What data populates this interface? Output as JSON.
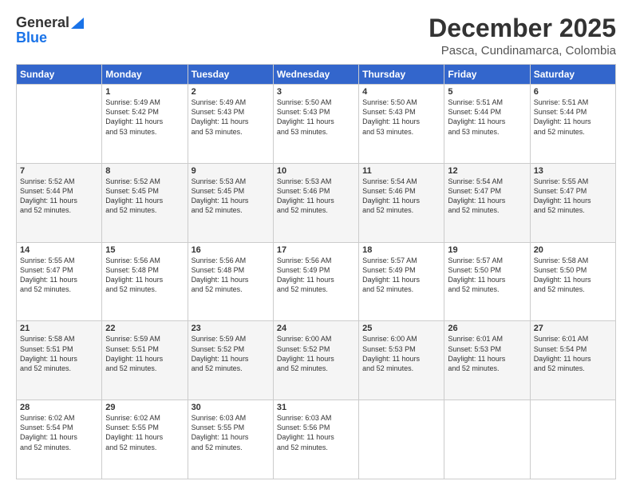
{
  "header": {
    "logo_general": "General",
    "logo_blue": "Blue",
    "title": "December 2025",
    "subtitle": "Pasca, Cundinamarca, Colombia"
  },
  "calendar": {
    "days_of_week": [
      "Sunday",
      "Monday",
      "Tuesday",
      "Wednesday",
      "Thursday",
      "Friday",
      "Saturday"
    ],
    "weeks": [
      [
        {
          "date": "",
          "info": ""
        },
        {
          "date": "1",
          "info": "Sunrise: 5:49 AM\nSunset: 5:42 PM\nDaylight: 11 hours\nand 53 minutes."
        },
        {
          "date": "2",
          "info": "Sunrise: 5:49 AM\nSunset: 5:43 PM\nDaylight: 11 hours\nand 53 minutes."
        },
        {
          "date": "3",
          "info": "Sunrise: 5:50 AM\nSunset: 5:43 PM\nDaylight: 11 hours\nand 53 minutes."
        },
        {
          "date": "4",
          "info": "Sunrise: 5:50 AM\nSunset: 5:43 PM\nDaylight: 11 hours\nand 53 minutes."
        },
        {
          "date": "5",
          "info": "Sunrise: 5:51 AM\nSunset: 5:44 PM\nDaylight: 11 hours\nand 53 minutes."
        },
        {
          "date": "6",
          "info": "Sunrise: 5:51 AM\nSunset: 5:44 PM\nDaylight: 11 hours\nand 52 minutes."
        }
      ],
      [
        {
          "date": "7",
          "info": "Sunrise: 5:52 AM\nSunset: 5:44 PM\nDaylight: 11 hours\nand 52 minutes."
        },
        {
          "date": "8",
          "info": "Sunrise: 5:52 AM\nSunset: 5:45 PM\nDaylight: 11 hours\nand 52 minutes."
        },
        {
          "date": "9",
          "info": "Sunrise: 5:53 AM\nSunset: 5:45 PM\nDaylight: 11 hours\nand 52 minutes."
        },
        {
          "date": "10",
          "info": "Sunrise: 5:53 AM\nSunset: 5:46 PM\nDaylight: 11 hours\nand 52 minutes."
        },
        {
          "date": "11",
          "info": "Sunrise: 5:54 AM\nSunset: 5:46 PM\nDaylight: 11 hours\nand 52 minutes."
        },
        {
          "date": "12",
          "info": "Sunrise: 5:54 AM\nSunset: 5:47 PM\nDaylight: 11 hours\nand 52 minutes."
        },
        {
          "date": "13",
          "info": "Sunrise: 5:55 AM\nSunset: 5:47 PM\nDaylight: 11 hours\nand 52 minutes."
        }
      ],
      [
        {
          "date": "14",
          "info": "Sunrise: 5:55 AM\nSunset: 5:47 PM\nDaylight: 11 hours\nand 52 minutes."
        },
        {
          "date": "15",
          "info": "Sunrise: 5:56 AM\nSunset: 5:48 PM\nDaylight: 11 hours\nand 52 minutes."
        },
        {
          "date": "16",
          "info": "Sunrise: 5:56 AM\nSunset: 5:48 PM\nDaylight: 11 hours\nand 52 minutes."
        },
        {
          "date": "17",
          "info": "Sunrise: 5:56 AM\nSunset: 5:49 PM\nDaylight: 11 hours\nand 52 minutes."
        },
        {
          "date": "18",
          "info": "Sunrise: 5:57 AM\nSunset: 5:49 PM\nDaylight: 11 hours\nand 52 minutes."
        },
        {
          "date": "19",
          "info": "Sunrise: 5:57 AM\nSunset: 5:50 PM\nDaylight: 11 hours\nand 52 minutes."
        },
        {
          "date": "20",
          "info": "Sunrise: 5:58 AM\nSunset: 5:50 PM\nDaylight: 11 hours\nand 52 minutes."
        }
      ],
      [
        {
          "date": "21",
          "info": "Sunrise: 5:58 AM\nSunset: 5:51 PM\nDaylight: 11 hours\nand 52 minutes."
        },
        {
          "date": "22",
          "info": "Sunrise: 5:59 AM\nSunset: 5:51 PM\nDaylight: 11 hours\nand 52 minutes."
        },
        {
          "date": "23",
          "info": "Sunrise: 5:59 AM\nSunset: 5:52 PM\nDaylight: 11 hours\nand 52 minutes."
        },
        {
          "date": "24",
          "info": "Sunrise: 6:00 AM\nSunset: 5:52 PM\nDaylight: 11 hours\nand 52 minutes."
        },
        {
          "date": "25",
          "info": "Sunrise: 6:00 AM\nSunset: 5:53 PM\nDaylight: 11 hours\nand 52 minutes."
        },
        {
          "date": "26",
          "info": "Sunrise: 6:01 AM\nSunset: 5:53 PM\nDaylight: 11 hours\nand 52 minutes."
        },
        {
          "date": "27",
          "info": "Sunrise: 6:01 AM\nSunset: 5:54 PM\nDaylight: 11 hours\nand 52 minutes."
        }
      ],
      [
        {
          "date": "28",
          "info": "Sunrise: 6:02 AM\nSunset: 5:54 PM\nDaylight: 11 hours\nand 52 minutes."
        },
        {
          "date": "29",
          "info": "Sunrise: 6:02 AM\nSunset: 5:55 PM\nDaylight: 11 hours\nand 52 minutes."
        },
        {
          "date": "30",
          "info": "Sunrise: 6:03 AM\nSunset: 5:55 PM\nDaylight: 11 hours\nand 52 minutes."
        },
        {
          "date": "31",
          "info": "Sunrise: 6:03 AM\nSunset: 5:56 PM\nDaylight: 11 hours\nand 52 minutes."
        },
        {
          "date": "",
          "info": ""
        },
        {
          "date": "",
          "info": ""
        },
        {
          "date": "",
          "info": ""
        }
      ]
    ]
  }
}
